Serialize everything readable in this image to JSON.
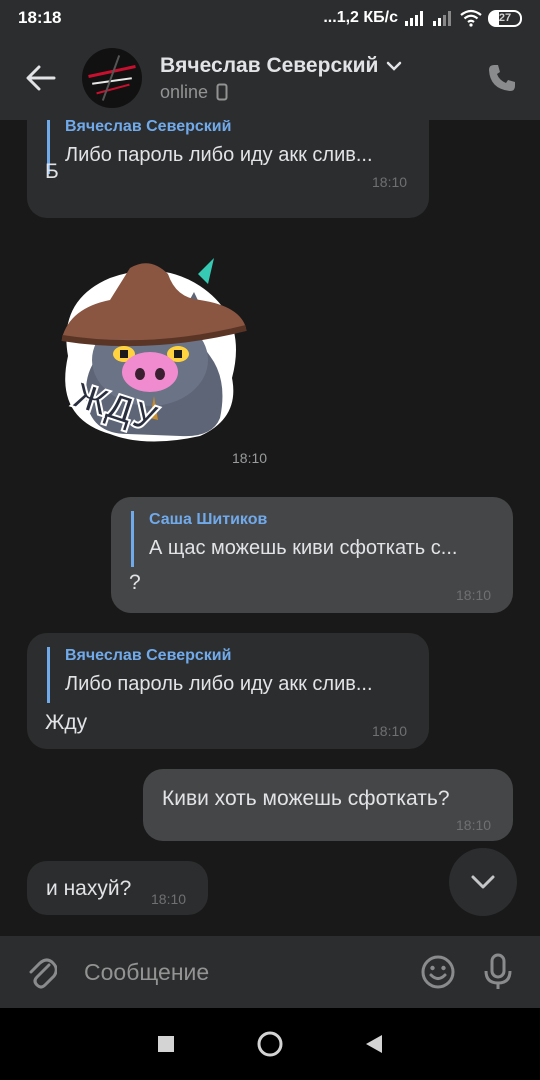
{
  "status_bar": {
    "time": "18:18",
    "network": "...1,2 КБ/с",
    "battery": "27"
  },
  "header": {
    "name": "Вячеслав Северский",
    "status": "online"
  },
  "messages": [
    {
      "direction": "in",
      "reply_author": "Вячеслав Северский",
      "reply_text": "Либо пароль либо иду акк слив...",
      "text": "Б",
      "time": "18:10"
    },
    {
      "direction": "in",
      "sticker_text": "ЖДУ",
      "time": "18:10"
    },
    {
      "direction": "out",
      "reply_author": "Саша Шитиков",
      "reply_text": "А щас можешь киви сфоткать с...",
      "text": "?",
      "time": "18:10"
    },
    {
      "direction": "in",
      "reply_author": "Вячеслав Северский",
      "reply_text": "Либо пароль либо иду акк слив...",
      "text": "Жду",
      "time": "18:10"
    },
    {
      "direction": "out",
      "text": "Киви хоть можешь сфоткать?",
      "time": "18:10"
    },
    {
      "direction": "in",
      "text": "и нахуй?",
      "time": "18:10"
    }
  ],
  "composer": {
    "placeholder": "Сообщение"
  },
  "colors": {
    "background": "#19191a",
    "bar": "#2c2d2e",
    "incoming_bubble": "#2c2d2e",
    "outgoing_bubble": "#454647",
    "accent": "#71aaeb"
  },
  "icons": {
    "back": "arrow-left-icon",
    "call": "phone-icon",
    "attach": "paperclip-icon",
    "emoji": "smile-icon",
    "mic": "microphone-icon",
    "scroll": "chevron-down-icon"
  }
}
